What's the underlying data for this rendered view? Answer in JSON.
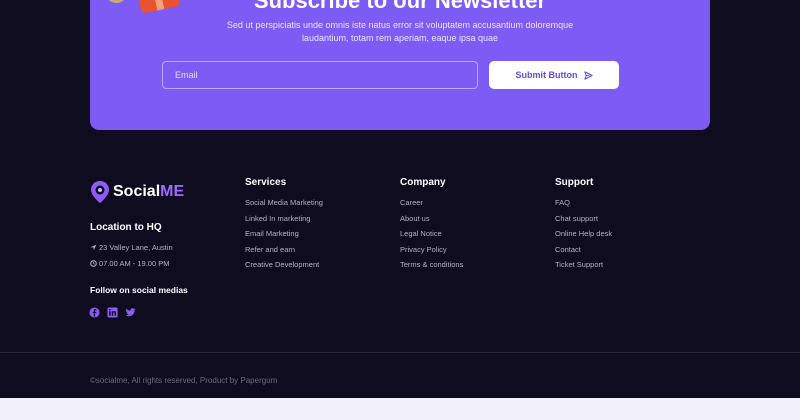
{
  "newsletter": {
    "title": "Subscribe to our Newsletter",
    "description": "Sed ut perspiciatis unde omnis iste natus error sit voluptatem accusantium doloremque laudantium, totam rem aperiam, eaque ipsa quae",
    "email_placeholder": "Email",
    "submit_label": "Submit Button",
    "submit_icon": "send-icon",
    "accent_color": "#7c5cf5"
  },
  "brand": {
    "name_primary": "Social",
    "name_accent": "ME",
    "logo_icon": "location-pin-icon"
  },
  "location": {
    "title": "Location to HQ",
    "address": "23 Valley Lane, Austin",
    "hours": "07.00 AM - 19.00 PM"
  },
  "social": {
    "title": "Follow on social medias",
    "icons": [
      "facebook-icon",
      "linkedin-icon",
      "twitter-icon"
    ]
  },
  "columns": [
    {
      "title": "Services",
      "items": [
        "Social Media Marketing",
        "Linked In marketing",
        "Email Marketing",
        "Refer and earn",
        "Creative Development"
      ]
    },
    {
      "title": "Company",
      "items": [
        "Career",
        "About us",
        "Legal Notice",
        "Privacy Policy",
        "Terms & conditions"
      ]
    },
    {
      "title": "Support",
      "items": [
        "FAQ",
        "Chat support",
        "Online Help desk",
        "Contact",
        "Ticket Support"
      ]
    }
  ],
  "copyright": "©socialme, All rights reserved, Product by Papergum"
}
